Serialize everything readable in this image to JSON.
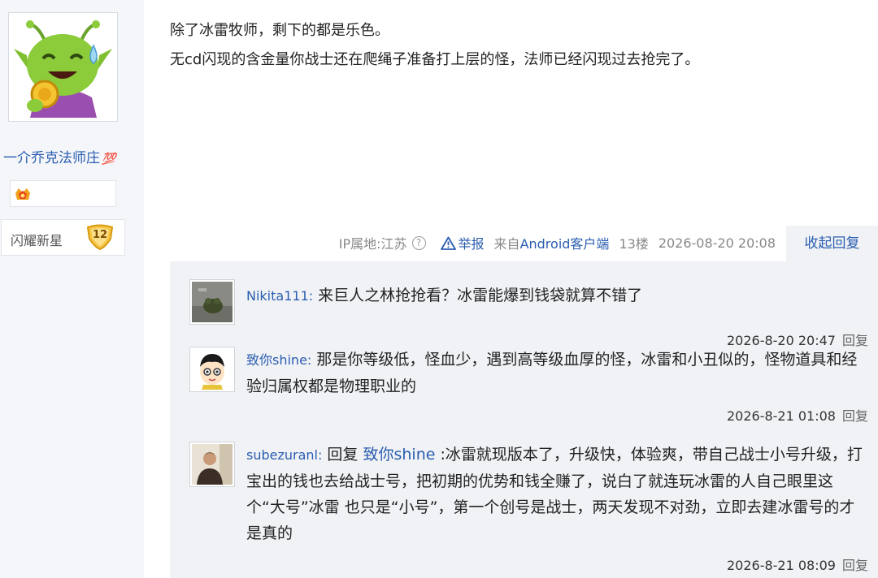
{
  "user": {
    "name": "一介乔克法师庄",
    "name_suffix": "💯",
    "badge_label": "闪耀新星",
    "badge_level": "12"
  },
  "post": {
    "lines": [
      "除了冰雷牧师，剩下的都是乐色。",
      "无cd闪现的含金量你战士还在爬绳子准备打上层的怪，法师已经闪现过去抢完了。"
    ]
  },
  "meta": {
    "ip": "IP属地:江苏",
    "help": "?",
    "report": "举报",
    "from_prefix": "来自",
    "client": "Android客户端",
    "floor": "13楼",
    "date": "2026-08-20 20:08",
    "collapse": "收起回复"
  },
  "replies": [
    {
      "user": "Nikita111:",
      "text": " 来巨人之林抢抢看？冰雷能爆到钱袋就算不错了",
      "time": "2026-8-20 20:47",
      "reply_label": "回复"
    },
    {
      "user": "致你shine:",
      "text": " 那是你等级低，怪血少，遇到高等级血厚的怪，冰雷和小丑似的，怪物道具和经验归属权都是物理职业的",
      "time": "2026-8-21 01:08",
      "reply_label": "回复"
    },
    {
      "user": "subezuranl:",
      "reply_prefix": " 回复 ",
      "mention": "致你shine",
      "text": " :冰雷就现版本了，升级快，体验爽，带自己战士小号升级，打宝出的钱也去给战士号，把初期的优势和钱全赚了，说白了就连玩冰雷的人自己眼里这个“大号”冰雷 也只是“小号”，第一个创号是战士，两天发现不对劲，立即去建冰雷号的才是真的",
      "time": "2026-8-21 08:09",
      "reply_label": "回复"
    }
  ],
  "colors": {
    "link": "#2a5db0",
    "sidebar_bg": "#f4f6f9",
    "reply_bg": "#f0f2f5",
    "meta_text": "#888888"
  },
  "icons": [
    "goblin-avatar",
    "medal-icon",
    "level-badge-icon",
    "help-icon",
    "warning-triangle-icon",
    "frog-avatar",
    "cartoon-boy-avatar",
    "man-photo-avatar"
  ]
}
